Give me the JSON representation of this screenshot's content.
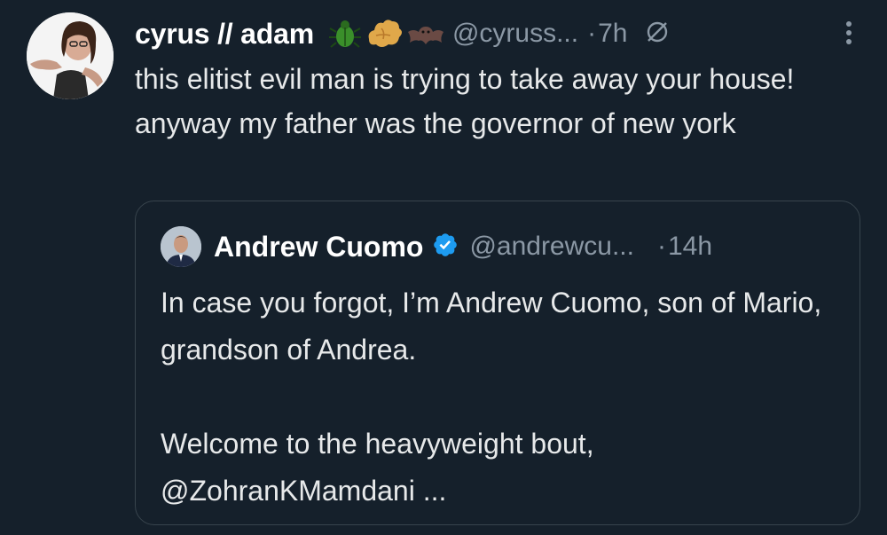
{
  "tweet": {
    "author_name": "cyrus // adam",
    "author_emojis": [
      "beetle-icon",
      "ginger-icon",
      "bat-icon"
    ],
    "author_handle": "@cyruss...",
    "separator": "·",
    "time": "7h",
    "text": "this elitist evil man is trying to take away your house! anyway my father was the governor of new york"
  },
  "quote": {
    "author_name": "Andrew Cuomo",
    "verified": true,
    "author_handle": "@andrewcu...",
    "separator": "·",
    "time": "14h",
    "paragraph1": "In case you forgot, I’m Andrew Cuomo, son of Mario, grandson of Andrea.",
    "paragraph2": "Welcome to the heavyweight bout, @ZohranKMamdani ..."
  },
  "colors": {
    "background": "#15202b",
    "text": "#e7e9ea",
    "secondary": "#8b98a5",
    "border": "#38444d",
    "verified": "#1d9bf0"
  }
}
